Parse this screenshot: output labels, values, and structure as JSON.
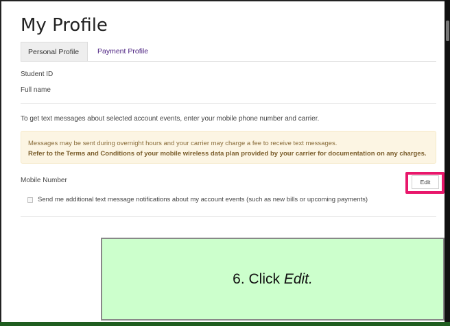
{
  "page": {
    "title": "My Profile"
  },
  "tabs": [
    {
      "label": "Personal Profile",
      "active": true
    },
    {
      "label": "Payment Profile",
      "active": false
    }
  ],
  "profile": {
    "student_id_label": "Student ID",
    "full_name_label": "Full name"
  },
  "sms": {
    "intro": "To get text messages about selected account events, enter your mobile phone number and carrier.",
    "notice_line1": "Messages may be sent during overnight hours and your carrier may charge a fee to receive text messages.",
    "notice_line2": "Refer to the Terms and Conditions of your mobile wireless data plan provided by your carrier for documentation on any charges.",
    "mobile_label": "Mobile Number",
    "edit_label": "Edit",
    "checkbox_label": "Send me additional text message notifications about my account events (such as new bills or upcoming payments)",
    "checkbox_checked": false
  },
  "callout": {
    "prefix": "6. Click ",
    "emphasis": "Edit.",
    "background": "#ccffcc"
  },
  "colors": {
    "accent_link": "#4b2180",
    "highlight_border": "#e8176b",
    "notice_bg": "#fcf5e3",
    "notice_text": "#8a6d3b"
  }
}
